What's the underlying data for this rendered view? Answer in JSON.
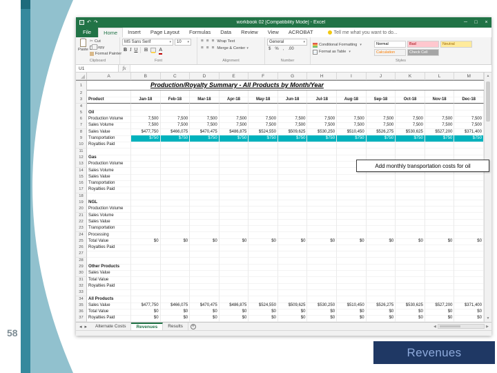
{
  "slide": {
    "page_number": "58",
    "footer": {
      "label": "Revenues"
    }
  },
  "callout": {
    "text": "Add monthly transportation costs for oil"
  },
  "colors": {
    "accent_teal": "#35899D",
    "accent_teal_light": "#85BAC9",
    "footer_navy": "#1F3864",
    "footer_text": "#8EAADB",
    "excel_green": "#217346",
    "row_highlight": "#00B2BD"
  },
  "excel": {
    "title_bar": {
      "title": "workbook 02 [Compatibility Mode] - Excel",
      "controls": {
        "minimize": "─",
        "maximize": "□",
        "close": "×"
      },
      "icons": {
        "undo": "↶",
        "redo": "↷"
      }
    },
    "file_tab": "File",
    "ribbon_tabs": [
      "Home",
      "Insert",
      "Page Layout",
      "Formulas",
      "Data",
      "Review",
      "View",
      "ACROBAT"
    ],
    "active_tab": "Home",
    "tell_me": "Tell me what you want to do...",
    "ribbon": {
      "clipboard": {
        "label": "Clipboard",
        "paste": "Paste",
        "cut": "Cut",
        "copy": "Copy",
        "format_painter": "Format Painter"
      },
      "font": {
        "label": "Font",
        "font_name": "MS Sans Serif",
        "font_size": "10"
      },
      "alignment": {
        "label": "Alignment",
        "wrap_text": "Wrap Text",
        "merge_center": "Merge & Center"
      },
      "number": {
        "label": "Number",
        "format": "General"
      },
      "styles": {
        "label": "Styles",
        "conditional": "Conditional Formatting",
        "format_table": "Format as Table",
        "cells": [
          {
            "label": "Normal",
            "bg": "#FFFFFF",
            "fg": "#000000"
          },
          {
            "label": "Bad",
            "bg": "#FFC7CE",
            "fg": "#9C0006"
          },
          {
            "label": "Neutral",
            "bg": "#FFEB9C",
            "fg": "#9C6500"
          },
          {
            "label": "Calculation",
            "bg": "#F2F2F2",
            "fg": "#FA7D00"
          },
          {
            "label": "Check Cell",
            "bg": "#A5A5A5",
            "fg": "#FFFFFF"
          }
        ]
      }
    },
    "name_box": "U1",
    "fx_label": "fx",
    "grid": {
      "columns": [
        "A",
        "B",
        "C",
        "D",
        "E",
        "F",
        "G",
        "H",
        "I",
        "J",
        "K",
        "L",
        "M"
      ],
      "title": "Production/Royalty Summary - All Products by Month/Year",
      "product_label": "Product",
      "months": [
        "Jan-18",
        "Feb-18",
        "Mar-18",
        "Apr-18",
        "May-18",
        "Jun-18",
        "Jul-18",
        "Aug-18",
        "Sep-18",
        "Oct-18",
        "Nov-18",
        "Dec-18"
      ],
      "value_sets": {
        "volumes": [
          "7,500",
          "7,500",
          "7,500",
          "7,500",
          "7,500",
          "7,500",
          "7,500",
          "7,500",
          "7,500",
          "7,500",
          "7,500",
          "7,500"
        ],
        "sales": [
          "$477,750",
          "$466,075",
          "$470,475",
          "$486,875",
          "$524,550",
          "$509,625",
          "$530,250",
          "$510,450",
          "$526,275",
          "$530,625",
          "$527,200",
          "$371,400"
        ],
        "transport": [
          "$750",
          "$750",
          "$750",
          "$750",
          "$750",
          "$750",
          "$750",
          "$750",
          "$750",
          "$750",
          "$750",
          "$750"
        ],
        "zeros": [
          "$0",
          "$0",
          "$0",
          "$0",
          "$0",
          "$0",
          "$0",
          "$0",
          "$0",
          "$0",
          "$0",
          "$0"
        ]
      },
      "rows": [
        {
          "kind": "title"
        },
        {
          "kind": "blank"
        },
        {
          "kind": "header"
        },
        {
          "kind": "blank"
        },
        {
          "kind": "section",
          "label": "Oil"
        },
        {
          "kind": "data",
          "label": "Production Volume",
          "v": "volumes"
        },
        {
          "kind": "data",
          "label": "Sales Volume",
          "v": "volumes"
        },
        {
          "kind": "data",
          "label": "Sales Value",
          "v": "sales"
        },
        {
          "kind": "data",
          "label": "Transportation",
          "v": "transport",
          "highlight": true
        },
        {
          "kind": "data",
          "label": "Royalties Paid"
        },
        {
          "kind": "blank"
        },
        {
          "kind": "section",
          "label": "Gas"
        },
        {
          "kind": "data",
          "label": "Production Volume"
        },
        {
          "kind": "data",
          "label": "Sales Volume"
        },
        {
          "kind": "data",
          "label": "Sales Value"
        },
        {
          "kind": "data",
          "label": "Transportation"
        },
        {
          "kind": "data",
          "label": "Royalties Paid"
        },
        {
          "kind": "blank"
        },
        {
          "kind": "section",
          "label": "NGL"
        },
        {
          "kind": "data",
          "label": "Production Volume"
        },
        {
          "kind": "data",
          "label": "Sales Volume"
        },
        {
          "kind": "data",
          "label": "Sales Value"
        },
        {
          "kind": "data",
          "label": "Transportation"
        },
        {
          "kind": "data",
          "label": "Processing"
        },
        {
          "kind": "data",
          "label": "Total Value",
          "v": "zeros"
        },
        {
          "kind": "data",
          "label": "Royalties Paid"
        },
        {
          "kind": "blank"
        },
        {
          "kind": "blank"
        },
        {
          "kind": "section",
          "label": "Other Products"
        },
        {
          "kind": "data",
          "label": "Sales Value"
        },
        {
          "kind": "data",
          "label": "Total Value"
        },
        {
          "kind": "data",
          "label": "Royalties Paid"
        },
        {
          "kind": "blank"
        },
        {
          "kind": "section",
          "label": "All Products"
        },
        {
          "kind": "data",
          "label": "Sales Value",
          "v": "sales"
        },
        {
          "kind": "data",
          "label": "Total Value",
          "v": "zeros"
        },
        {
          "kind": "data",
          "label": "Royalties Paid",
          "v": "zeros"
        }
      ]
    },
    "sheet_tabs": {
      "tabs": [
        "Alternate Costs",
        "Revenues",
        "Results"
      ],
      "active": "Revenues"
    }
  }
}
